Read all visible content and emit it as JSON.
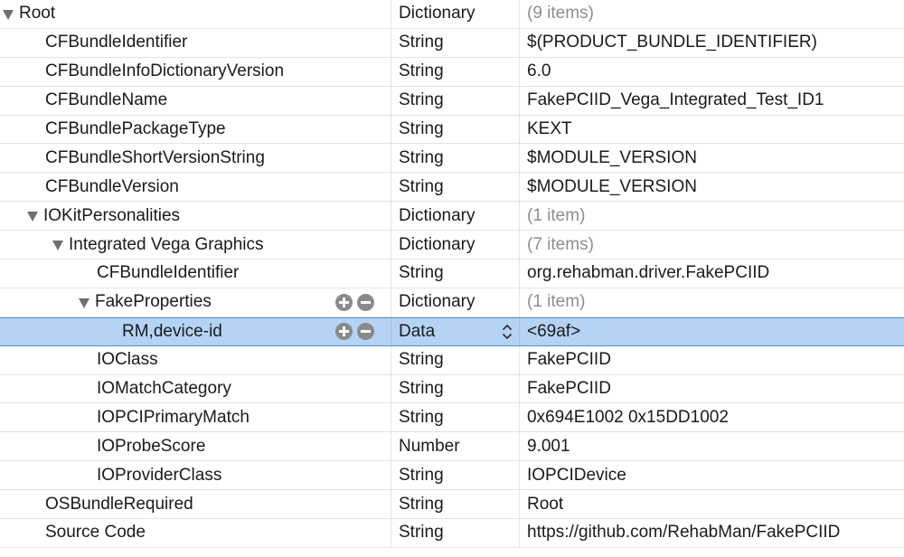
{
  "plist": {
    "rows": [
      {
        "key": "Root",
        "type": "Dictionary",
        "value": "(9 items)"
      },
      {
        "key": "CFBundleIdentifier",
        "type": "String",
        "value": "$(PRODUCT_BUNDLE_IDENTIFIER)"
      },
      {
        "key": "CFBundleInfoDictionaryVersion",
        "type": "String",
        "value": "6.0"
      },
      {
        "key": "CFBundleName",
        "type": "String",
        "value": "FakePCIID_Vega_Integrated_Test_ID1"
      },
      {
        "key": "CFBundlePackageType",
        "type": "String",
        "value": "KEXT"
      },
      {
        "key": "CFBundleShortVersionString",
        "type": "String",
        "value": "$MODULE_VERSION"
      },
      {
        "key": "CFBundleVersion",
        "type": "String",
        "value": "$MODULE_VERSION"
      },
      {
        "key": "IOKitPersonalities",
        "type": "Dictionary",
        "value": "(1 item)"
      },
      {
        "key": "Integrated Vega Graphics",
        "type": "Dictionary",
        "value": "(7 items)"
      },
      {
        "key": "CFBundleIdentifier",
        "type": "String",
        "value": "org.rehabman.driver.FakePCIID"
      },
      {
        "key": "FakeProperties",
        "type": "Dictionary",
        "value": "(1 item)"
      },
      {
        "key": "RM,device-id",
        "type": "Data",
        "value": "<69af>"
      },
      {
        "key": "IOClass",
        "type": "String",
        "value": "FakePCIID"
      },
      {
        "key": "IOMatchCategory",
        "type": "String",
        "value": "FakePCIID"
      },
      {
        "key": "IOPCIPrimaryMatch",
        "type": "String",
        "value": "0x694E1002 0x15DD1002"
      },
      {
        "key": "IOProbeScore",
        "type": "Number",
        "value": "9.001"
      },
      {
        "key": "IOProviderClass",
        "type": "String",
        "value": "IOPCIDevice"
      },
      {
        "key": "OSBundleRequired",
        "type": "String",
        "value": "Root"
      },
      {
        "key": "Source Code",
        "type": "String",
        "value": "https://github.com/RehabMan/FakePCIID"
      }
    ],
    "selected_row": 11,
    "colors": {
      "selection": "#b5d3f4",
      "selection_border": "#4a8fe0",
      "muted_text": "#8e8e8e"
    }
  }
}
